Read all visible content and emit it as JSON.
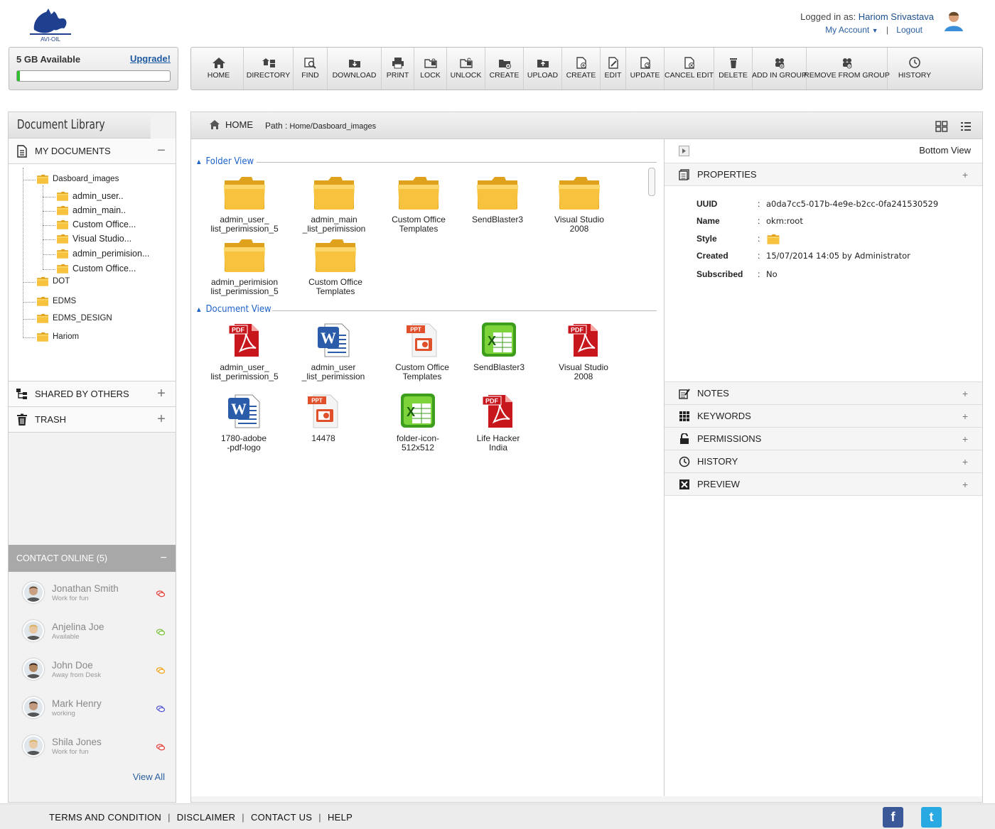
{
  "header": {
    "logo_text": "AVI-OIL",
    "logged_in_label": "Logged in as:",
    "user_name": "Hariom Srivastava",
    "my_account": "My Account",
    "separator": "|",
    "logout": "Logout"
  },
  "storage": {
    "available": "5 GB Available",
    "upgrade": "Upgrade!",
    "used_fraction": 0.02
  },
  "toolbar": [
    {
      "label": "HOME",
      "icon": "home-icon"
    },
    {
      "label": "DIRECTORY",
      "icon": "directory-icon"
    },
    {
      "label": "FIND",
      "icon": "find-icon"
    },
    {
      "label": "DOWNLOAD",
      "icon": "download-icon"
    },
    {
      "label": "PRINT",
      "icon": "print-icon"
    },
    {
      "label": "LOCK",
      "icon": "lock-icon"
    },
    {
      "label": "UNLOCK",
      "icon": "unlock-icon"
    },
    {
      "label": "CREATE",
      "icon": "create-folder-icon"
    },
    {
      "label": "UPLOAD",
      "icon": "upload-icon"
    },
    {
      "label": "CREATE",
      "icon": "create-document-icon"
    },
    {
      "label": "EDIT",
      "icon": "edit-icon"
    },
    {
      "label": "UPDATE",
      "icon": "update-icon"
    },
    {
      "label": "CANCEL EDIT",
      "icon": "cancel-edit-icon"
    },
    {
      "label": "DELETE",
      "icon": "delete-icon"
    },
    {
      "label": "ADD IN GROUP",
      "icon": "add-group-icon"
    },
    {
      "label": "REMOVE FROM GROUP",
      "icon": "remove-group-icon"
    },
    {
      "label": "HISTORY",
      "icon": "history-icon"
    }
  ],
  "left": {
    "title": "Document Library",
    "my_documents": "MY DOCUMENTS",
    "collapse": "−",
    "expand": "+",
    "tree": {
      "root": "Dasboard_images",
      "children": [
        "admin_user..",
        "admin_main..",
        "Custom Office...",
        "Visual Studio...",
        "admin_perimision...",
        "Custom Office..."
      ],
      "siblings": [
        "DOT",
        "EDMS",
        "EDMS_DESIGN",
        "Hariom"
      ]
    },
    "shared": "SHARED BY OTHERS",
    "trash": "TRASH",
    "contacts_title": "CONTACT ONLINE (5)",
    "contacts": [
      {
        "name": "Jonathan Smith",
        "status": "Work for fun",
        "color": "#e2463c"
      },
      {
        "name": "Anjelina Joe",
        "status": "Available",
        "color": "#7ec43f"
      },
      {
        "name": "John Doe",
        "status": "Away from Desk",
        "color": "#f2a51c"
      },
      {
        "name": "Mark Henry",
        "status": "working",
        "color": "#5a5ad6"
      },
      {
        "name": "Shila Jones",
        "status": "Work for fun",
        "color": "#e2463c"
      }
    ],
    "view_all": "View All"
  },
  "main": {
    "home": "HOME",
    "path_label": "Path :",
    "path": "Home/Dasboard_images",
    "folder_view": "Folder View",
    "document_view": "Document View",
    "folders": [
      [
        "admin_user_",
        "list_perimission_5"
      ],
      [
        "admin_main",
        "_list_perimission"
      ],
      [
        "Custom Office",
        "Templates"
      ],
      [
        "SendBlaster3",
        ""
      ],
      [
        "Visual Studio",
        "2008"
      ],
      [
        "admin_perimision",
        "list_perimission_5"
      ],
      [
        "Custom Office",
        "Templates"
      ]
    ],
    "documents": [
      {
        "l1": "admin_user_",
        "l2": "list_perimission_5",
        "type": "pdf"
      },
      {
        "l1": "admin_user",
        "l2": "_list_perimission",
        "type": "word"
      },
      {
        "l1": "Custom Office",
        "l2": "Templates",
        "type": "ppt"
      },
      {
        "l1": "SendBlaster3",
        "l2": "",
        "type": "excel"
      },
      {
        "l1": "Visual Studio",
        "l2": "2008",
        "type": "pdf"
      },
      {
        "l1": "1780-adobe",
        "l2": "-pdf-logo",
        "type": "word"
      },
      {
        "l1": "14478",
        "l2": "",
        "type": "ppt"
      },
      {
        "l1": "folder-icon-",
        "l2": "512x512",
        "type": "excel"
      },
      {
        "l1": "Life Hacker",
        "l2": "India",
        "type": "pdf"
      }
    ],
    "icon_badges": {
      "pdf": "PDF",
      "ppt": "PPT",
      "word": "W",
      "excel": "X"
    }
  },
  "right": {
    "bottom_view": "Bottom View",
    "properties": "PROPERTIES",
    "props": [
      {
        "k": "UUID",
        "v": "a0da7cc5-017b-4e9e-b2cc-0fa241530529"
      },
      {
        "k": "Name",
        "v": "okm:root"
      },
      {
        "k": "Style",
        "v": ""
      },
      {
        "k": "Created",
        "v": "15/07/2014  14:05 by Administrator"
      },
      {
        "k": "Subscribed",
        "v": "No"
      }
    ],
    "colon": ":",
    "sections": [
      "NOTES",
      "KEYWORDS",
      "PERMISSIONS",
      "HISTORY",
      "PREVIEW"
    ],
    "plus": "+"
  },
  "footer": {
    "links": [
      "TERMS AND CONDITION",
      "DISCLAIMER",
      "CONTACT US",
      "HELP"
    ],
    "facebook": "f",
    "twitter": "t"
  }
}
